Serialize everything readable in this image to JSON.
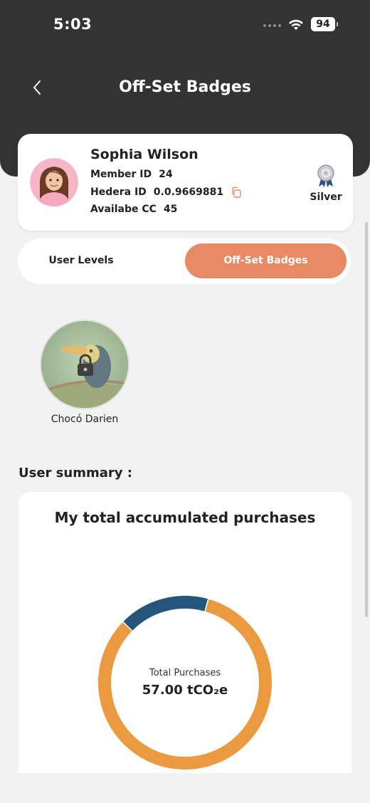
{
  "status_bar": {
    "time": "5:03",
    "battery": "94"
  },
  "header": {
    "title": "Off-Set Badges"
  },
  "profile": {
    "name": "Sophia Wilson",
    "member_id_label": "Member ID",
    "member_id": "24",
    "hedera_id_label": "Hedera ID",
    "hedera_id": "0.0.9669881",
    "cc_label": "Availabe CC",
    "cc_value": "45",
    "level": "Silver"
  },
  "tabs": [
    {
      "label": "User Levels",
      "active": false
    },
    {
      "label": "Off-Set Badges",
      "active": true
    }
  ],
  "badges": [
    {
      "label": "Chocó Darien",
      "locked": true
    }
  ],
  "summary": {
    "heading": "User summary :",
    "chart_title": "My total accumulated purchases",
    "center_caption": "Total Purchases",
    "center_value": "57.00 tCO₂e"
  },
  "colors": {
    "header_bg": "#333333",
    "accent": "#e88a66",
    "donut_orange": "#eb9a3f",
    "donut_blue": "#25557a"
  },
  "chart_data": {
    "type": "pie",
    "title": "My total accumulated purchases",
    "total_label": "Total Purchases",
    "total": "57.00 tCO₂e",
    "slices": [
      {
        "share_percent": 83,
        "color": "#eb9a3f"
      },
      {
        "share_percent": 17,
        "color": "#25557a"
      }
    ]
  }
}
